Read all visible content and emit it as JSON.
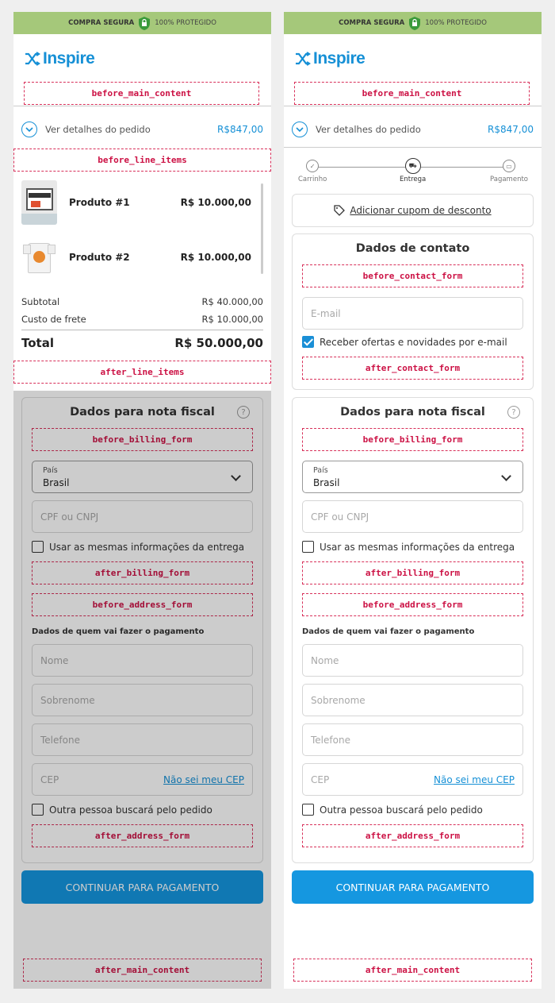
{
  "topbar": {
    "secure": "COMPRA SEGURA",
    "protected": "100% PROTEGIDO"
  },
  "logo": {
    "text": "Inspire"
  },
  "slots": {
    "before_main_content": "before_main_content",
    "before_line_items": "before_line_items",
    "after_line_items": "after_line_items",
    "before_contact_form": "before_contact_form",
    "after_contact_form": "after_contact_form",
    "before_billing_form": "before_billing_form",
    "after_billing_form": "after_billing_form",
    "before_address_form": "before_address_form",
    "after_address_form": "after_address_form",
    "after_main_content": "after_main_content"
  },
  "summary": {
    "label": "Ver detalhes do pedido",
    "price": "R$847,00"
  },
  "items": [
    {
      "name": "Produto #1",
      "price": "R$ 10.000,00"
    },
    {
      "name": "Produto #2",
      "price": "R$ 10.000,00"
    }
  ],
  "totals": {
    "subtotal_label": "Subtotal",
    "subtotal": "R$ 40.000,00",
    "shipping_label": "Custo de frete",
    "shipping": "R$ 10.000,00",
    "total_label": "Total",
    "total": "R$ 50.000,00"
  },
  "steps": [
    {
      "label": "Carrinho"
    },
    {
      "label": "Entrega"
    },
    {
      "label": "Pagamento"
    }
  ],
  "coupon": {
    "label": "Adicionar cupom de desconto"
  },
  "contact": {
    "title": "Dados de contato",
    "email_placeholder": "E-mail",
    "offers_label": "Receber ofertas e novidades por e-mail"
  },
  "billing": {
    "title": "Dados para nota fiscal",
    "help": "?",
    "country_label": "País",
    "country_value": "Brasil",
    "cpf_placeholder": "CPF ou CNPJ",
    "same_info_label": "Usar as mesmas informações da entrega"
  },
  "address": {
    "subtitle": "Dados de quem vai fazer o pagamento",
    "name_placeholder": "Nome",
    "surname_placeholder": "Sobrenome",
    "phone_placeholder": "Telefone",
    "cep_placeholder": "CEP",
    "cep_link": "Não sei meu CEP",
    "other_person_label": "Outra pessoa buscará pelo pedido"
  },
  "cta": {
    "label": "CONTINUAR PARA PAGAMENTO"
  },
  "colors": {
    "accent": "#1690d6",
    "topbar": "#a5c87a",
    "slot": "#d8305a",
    "button": "#1597e0"
  }
}
